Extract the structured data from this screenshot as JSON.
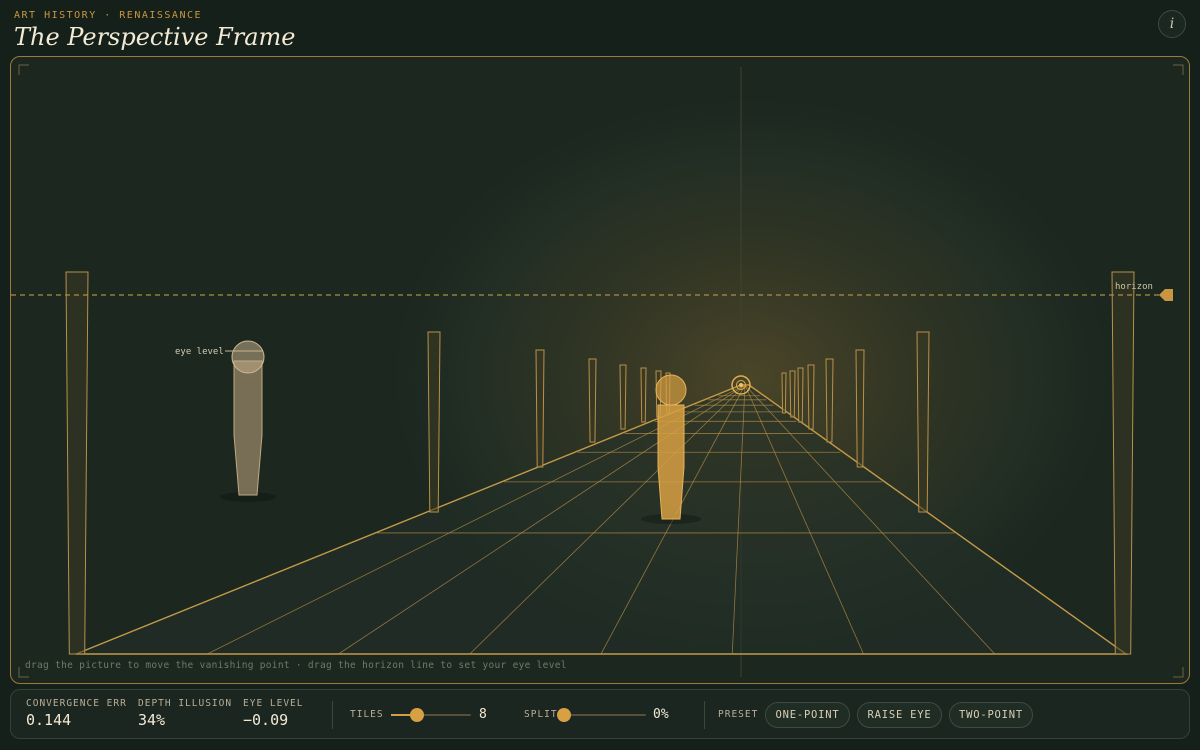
{
  "header": {
    "eyebrow": "ART HISTORY · RENAISSANCE",
    "title": "The Perspective Frame",
    "info_icon": "i"
  },
  "canvas": {
    "horizon_label": "horizon",
    "eye_level_label": "eye level",
    "hint": "drag the picture to move the vanishing point · drag the horizon line to set your eye level"
  },
  "stats": [
    {
      "label": "CONVERGENCE ERR",
      "value": "0.144"
    },
    {
      "label": "DEPTH ILLUSION",
      "value": "34%"
    },
    {
      "label": "EYE LEVEL",
      "value": "−0.09"
    }
  ],
  "tiles": {
    "label": "TILES",
    "value": "8",
    "fraction": 0.33
  },
  "split": {
    "label": "SPLIT",
    "value": "0%",
    "fraction": 0.0
  },
  "preset": {
    "label": "PRESET",
    "buttons": [
      "ONE-POINT",
      "RAISE EYE",
      "TWO-POINT"
    ]
  },
  "colors": {
    "accent": "#d7a043",
    "background": "#142019",
    "frame_border": "#9c7a3a"
  }
}
